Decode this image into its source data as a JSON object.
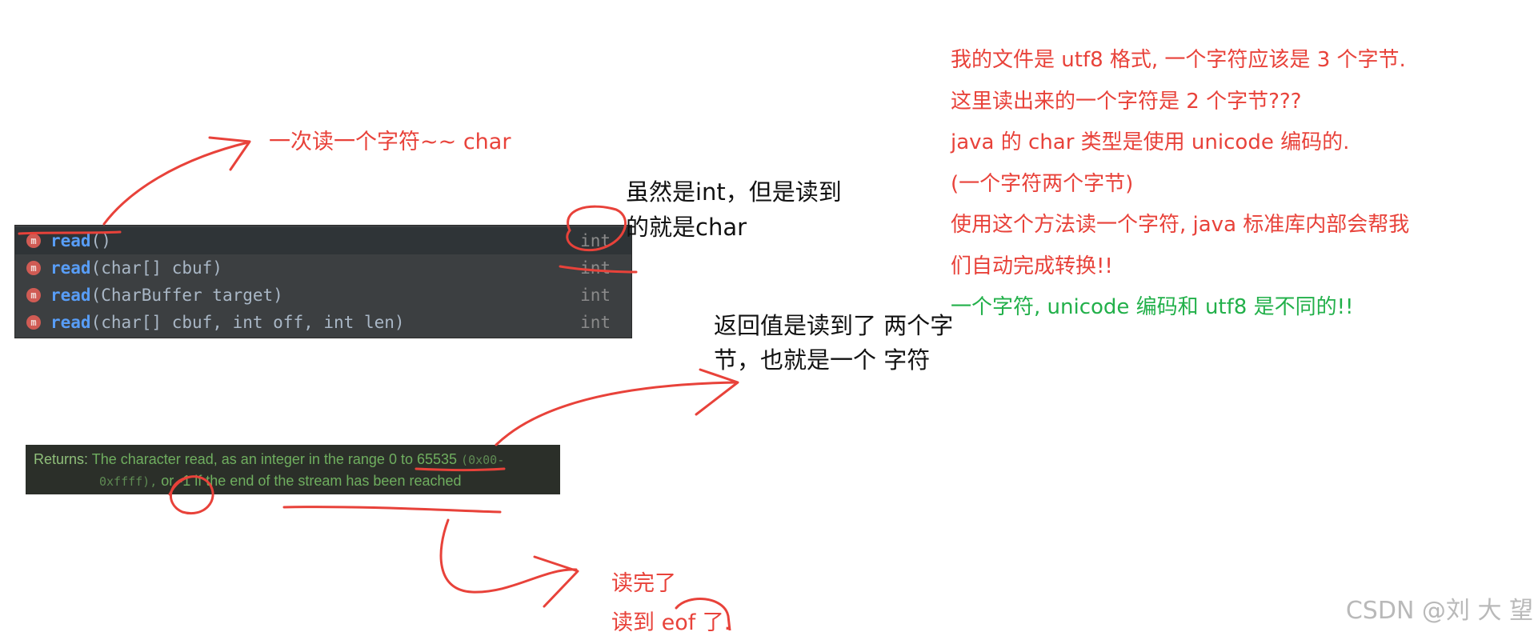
{
  "popup": {
    "items": [
      {
        "name": "read",
        "args": "()",
        "return_type": "int"
      },
      {
        "name": "read",
        "args": "(char[] cbuf)",
        "return_type": "int"
      },
      {
        "name": "read",
        "args": "(CharBuffer target)",
        "return_type": "int"
      },
      {
        "name": "read",
        "args": "(char[] cbuf, int off, int len)",
        "return_type": "int"
      }
    ],
    "icon_letter": "m"
  },
  "doc": {
    "label": "Returns:",
    "text1": "The character read, as an integer in the range 0 to 65535",
    "hex_range1": "(0x00-",
    "hex_range2": "0xffff),",
    "text2": "or -1 if the end of the stream has been reached"
  },
  "annotations": {
    "read_one_char": "一次读一个字符~~ char",
    "int_note_line1": "虽然是int，但是读到",
    "int_note_line2": "的就是char",
    "return_note_line1": "返回值是读到了 两个字",
    "return_note_line2": "节，也就是一个 字符",
    "eof_line1": "读完了",
    "eof_line2": "读到 eof 了.",
    "red_block": [
      "我的文件是 utf8 格式, 一个字符应该是 3 个字节.",
      "这里读出来的一个字符是 2 个字节???",
      "java 的 char 类型是使用 unicode 编码的.",
      "(一个字符两个字节)",
      "使用这个方法读一个字符, java 标准库内部会帮我",
      "们自动完成转换!!"
    ],
    "green_note": "一个字符, unicode 编码和 utf8 是不同的!!"
  },
  "watermark": "CSDN @刘 大 望",
  "colors": {
    "annotation_red": "#e8423a",
    "annotation_green": "#22b04a",
    "popup_bg": "#3c3f41",
    "method_blue": "#589df6"
  }
}
